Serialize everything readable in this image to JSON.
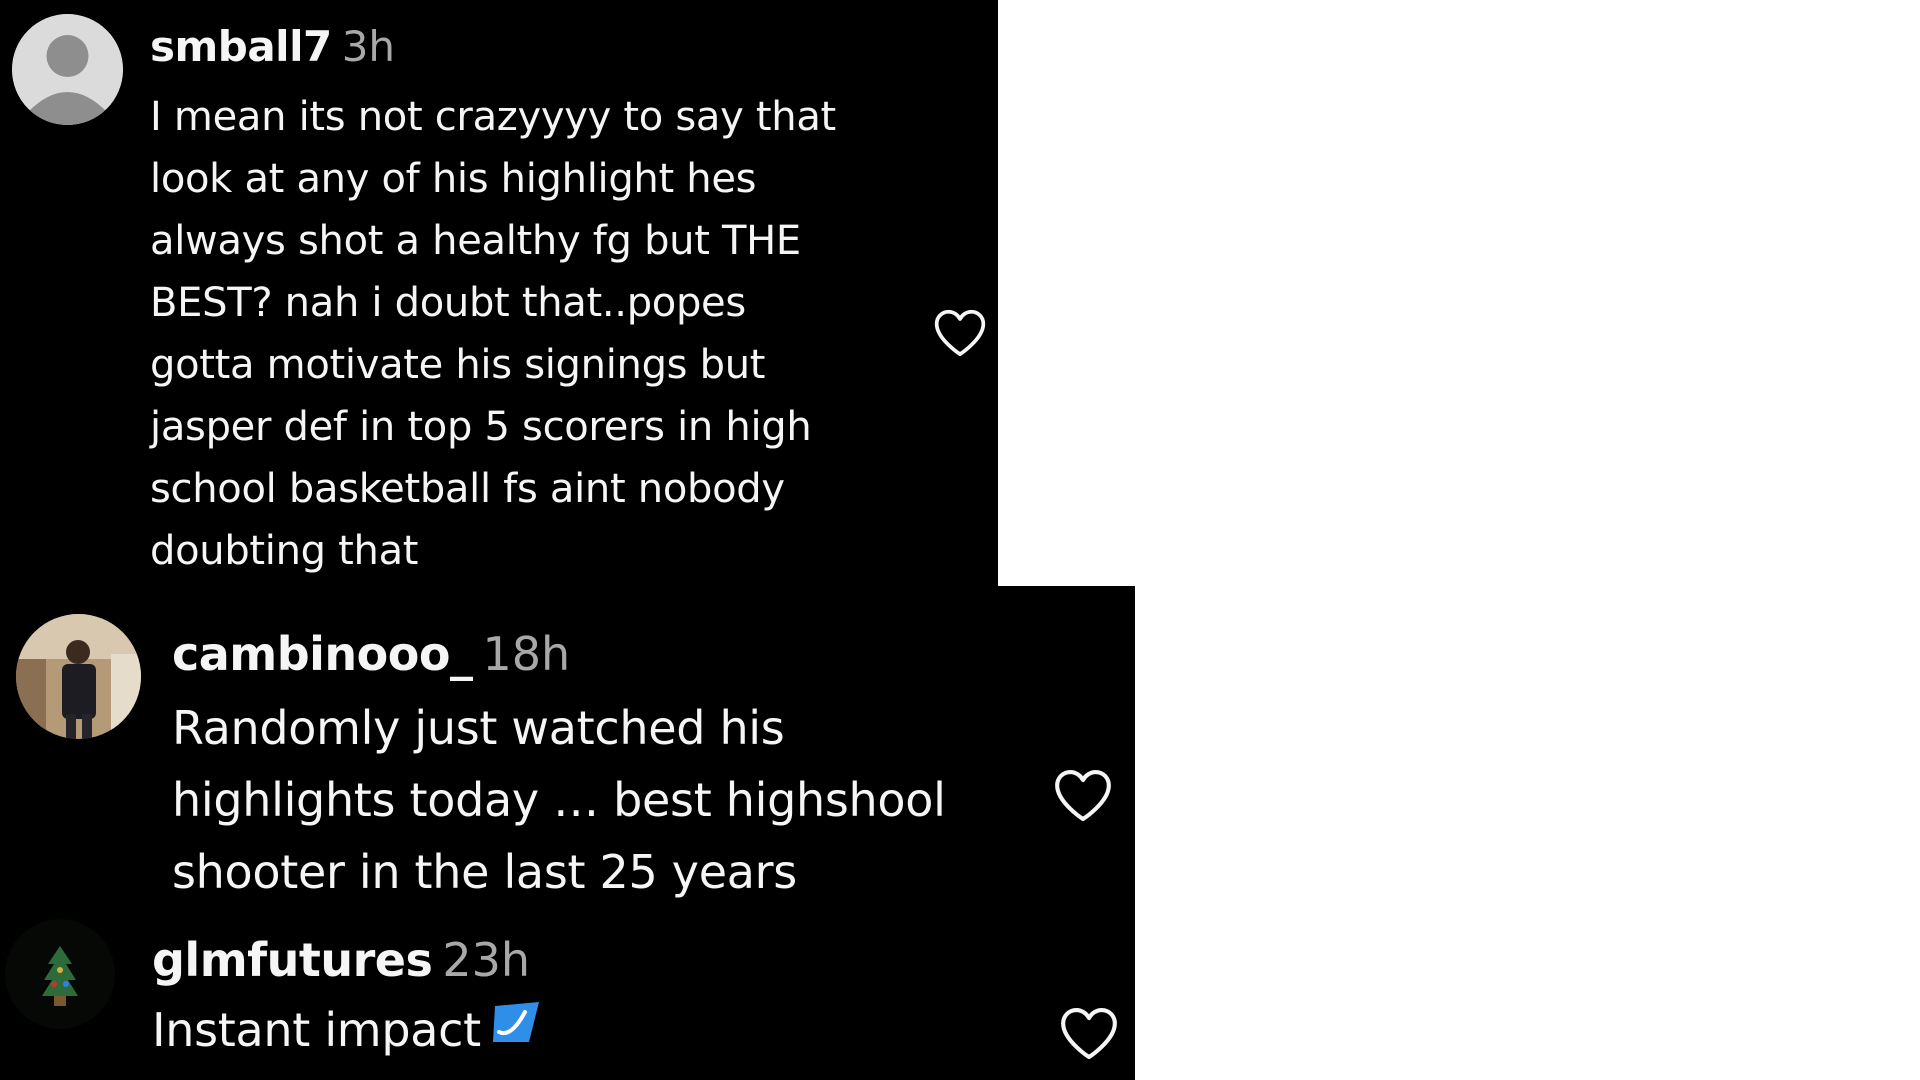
{
  "comments": [
    {
      "username": "smball7",
      "time": "3h",
      "text": "I mean its not crazyyyy to say that\nlook at any of his highlight hes\nalways shot a healthy fg but THE\nBEST? nah i doubt that..popes\ngotta motivate his signings but\njasper def in top 5 scorers in high\nschool basketball fs aint nobody\ndoubting that",
      "avatar": "default-avatar-icon",
      "like_icon": "heart-outline-icon"
    },
    {
      "username": "cambinooo_",
      "time": "18h",
      "text": "Randomly just watched his\nhighlights today … best highshool\nshooter in the last 25 years",
      "avatar": "photo-avatar",
      "like_icon": "heart-outline-icon"
    },
    {
      "username": "glmfutures",
      "time": "23h",
      "text": "Instant impact",
      "emoji": "blue-heart-emoji",
      "avatar": "logo-avatar",
      "like_icon": "heart-outline-icon"
    }
  ],
  "colors": {
    "background": "#000000",
    "text": "#f5f5f5",
    "muted": "#a8a8a8",
    "page": "#ffffff"
  }
}
